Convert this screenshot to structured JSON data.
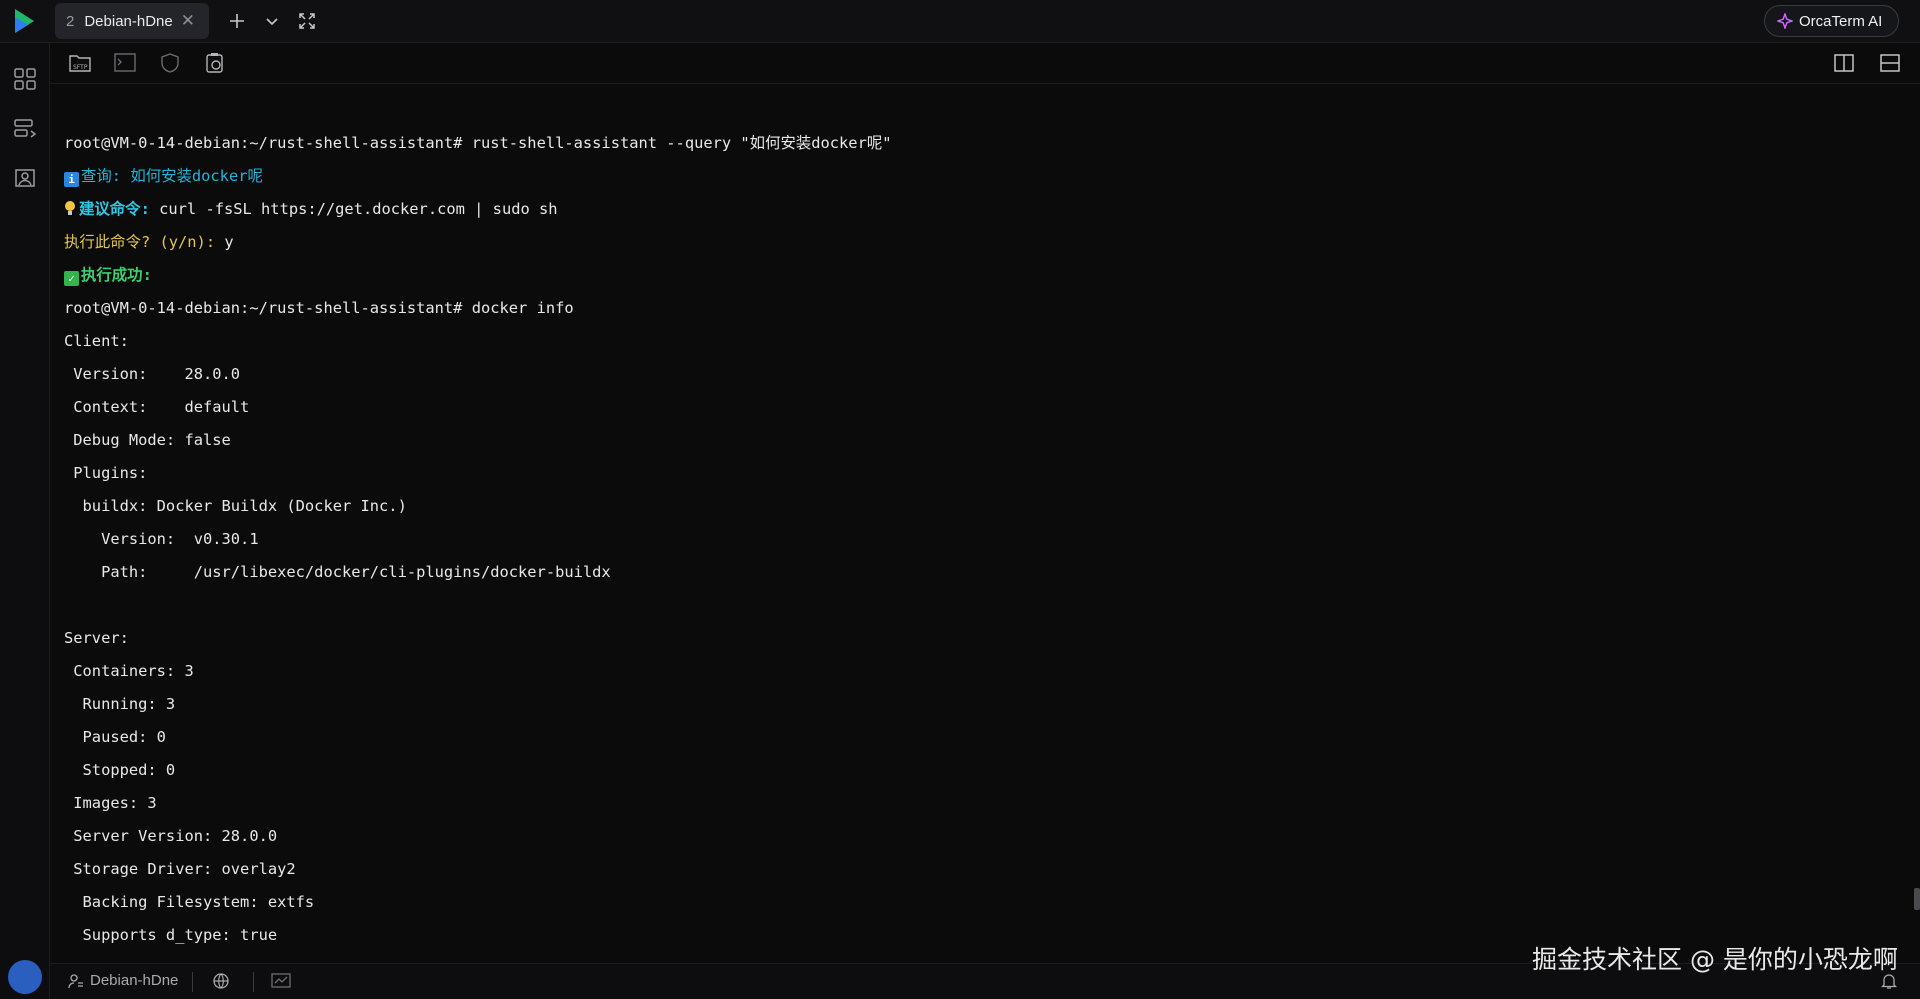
{
  "tab": {
    "number": "2",
    "title": "Debian-hDne"
  },
  "ai_button": {
    "label": "OrcaTerm AI"
  },
  "status_bar": {
    "host": "Debian-hDne"
  },
  "watermark": "掘金技术社区 @ 是你的小恐龙啊",
  "terminal": {
    "lines": [
      "root@VM-0-14-debian:~/rust-shell-assistant# rust-shell-assistant --query \"如何安装docker呢\"",
      "查询: 如何安装docker呢",
      "建议命令:",
      " curl -fsSL https://get.docker.com | sudo sh",
      "执行此命令? (y/n):",
      " y",
      "执行成功:",
      "root@VM-0-14-debian:~/rust-shell-assistant# docker info",
      "Client:",
      " Version:    28.0.0",
      " Context:    default",
      " Debug Mode: false",
      " Plugins:",
      "  buildx: Docker Buildx (Docker Inc.)",
      "    Version:  v0.30.1",
      "    Path:     /usr/libexec/docker/cli-plugins/docker-buildx",
      "",
      "Server:",
      " Containers: 3",
      "  Running: 3",
      "  Paused: 0",
      "  Stopped: 0",
      " Images: 3",
      " Server Version: 28.0.0",
      " Storage Driver: overlay2",
      "  Backing Filesystem: extfs",
      "  Supports d_type: true"
    ]
  },
  "colors": {
    "background": "#0b0b0c",
    "info_cyan": "#27b3d6",
    "prompt_yellow": "#e2c84a",
    "success_green": "#3fcf6e"
  },
  "icons": {
    "top": [
      "app-logo",
      "add-tab-icon",
      "chevron-down-icon",
      "fullscreen-icon"
    ],
    "toolbar": [
      "sftp-icon",
      "terminal-icon",
      "shield-icon",
      "clipboard-icon",
      "split-vertical-icon",
      "split-horizontal-icon"
    ],
    "sidebar": [
      "dashboard-icon",
      "server-list-icon",
      "profile-icon"
    ],
    "status": [
      "host-icon",
      "globe-icon",
      "monitor-icon",
      "bell-icon"
    ]
  }
}
